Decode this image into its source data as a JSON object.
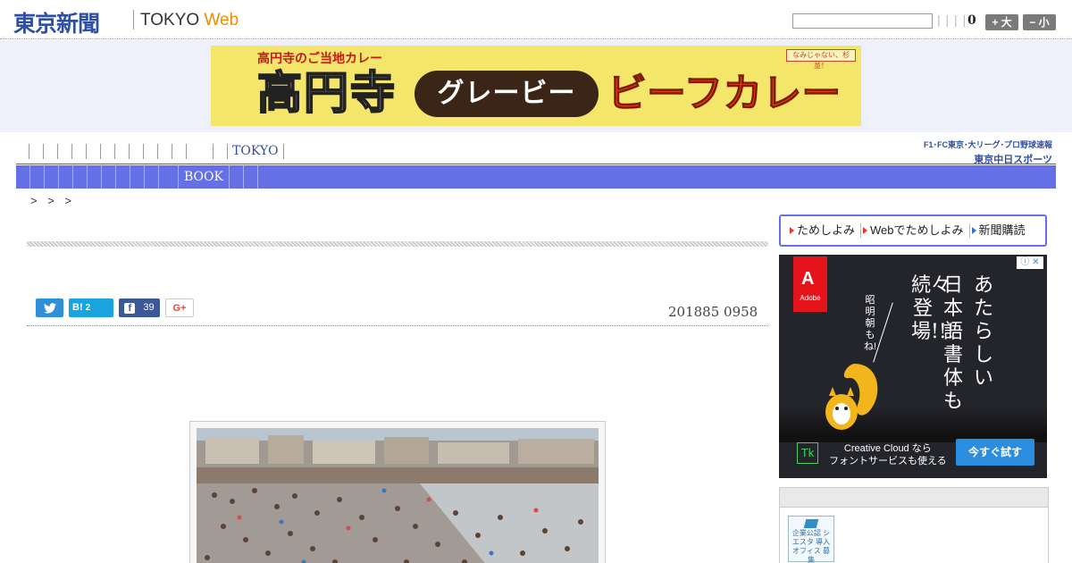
{
  "header": {
    "logo_jp": "東京新聞",
    "logo_en": "TOKYO",
    "logo_web": "Web",
    "search_placeholder": "",
    "pipes": "| | | |",
    "count": "0",
    "font_large": "+ 大",
    "font_small": "− 小"
  },
  "banner": {
    "subtitle": "高円寺のご当地カレー",
    "title_main": "高円寺",
    "title_pill": "グレービー",
    "title_tail": "ビーフカレー",
    "mini_badge": "なみじゃない、杉並！"
  },
  "nav1": {
    "items": [
      "",
      "",
      "",
      "",
      "",
      "",
      "",
      "",
      "",
      "",
      "",
      "",
      "",
      "TOKYO"
    ],
    "partner_line1": "F1･FC東京･大リーグ･プロ野球速報",
    "partner_line2": "東京中日スポーツ"
  },
  "nav2": {
    "items": [
      "",
      "",
      "",
      "",
      "",
      "",
      "",
      "",
      "",
      "",
      "",
      "BOOK",
      "",
      ""
    ]
  },
  "breadcrumb": "> > >",
  "article": {
    "share": {
      "twitter": "",
      "hatena_label": "B!",
      "hatena_count": "2",
      "facebook_label": "f",
      "facebook_count": "39",
      "gplus": "G+"
    },
    "date": "201885 0958"
  },
  "sidebar": {
    "links": [
      "ためしよみ",
      "Webでためしよみ",
      "新聞購読"
    ],
    "ad": {
      "brand": "Adobe",
      "col1": "あたらしい",
      "col2": "日本語書体も",
      "col3": "続々登場!!!",
      "small": "昭明朝もね!",
      "tk": "Tk",
      "cc_line1": "Creative Cloud なら",
      "cc_line2": "フォントサービスも使える",
      "cta": "今すぐ試す",
      "adchoice": "ⓘ ✕"
    },
    "badge": "企業公認 シエスタ 導入オフィス 募集"
  },
  "colors": {
    "brand_blue": "#2f4fa0",
    "nav_purple": "#6670e6",
    "accent_orange": "#f08c00"
  }
}
